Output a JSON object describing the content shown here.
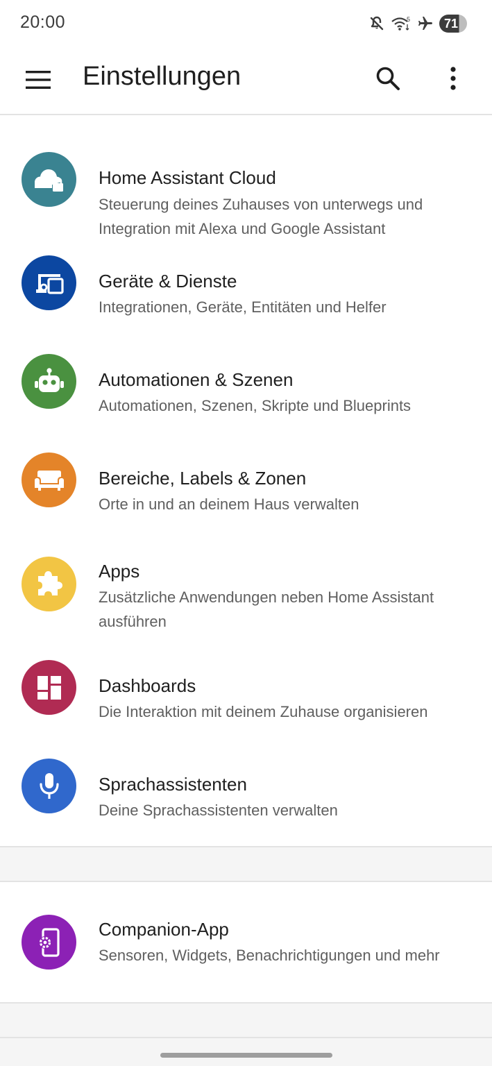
{
  "status_bar": {
    "time": "20:00",
    "battery": "71",
    "icons": [
      "mute-icon",
      "wifi-icon",
      "airplane-icon",
      "battery-icon"
    ]
  },
  "toolbar": {
    "title": "Einstellungen",
    "icons": [
      "menu-icon",
      "search-icon",
      "more-vert-icon"
    ]
  },
  "items": [
    {
      "title": "Home Assistant Cloud",
      "description": "Steuerung deines Zuhauses von unterwegs und Integration mit Alexa und Google Assistant",
      "icon": "cloud-lock-icon",
      "color": "#3a8391"
    },
    {
      "title": "Geräte & Dienste",
      "description": "Integrationen, Geräte, Entitäten und Helfer",
      "icon": "devices-icon",
      "color": "#0c47a1"
    },
    {
      "title": "Automationen & Szenen",
      "description": "Automationen, Szenen, Skripte und Blueprints",
      "icon": "robot-icon",
      "color": "#4a9140"
    },
    {
      "title": "Bereiche, Labels & Zonen",
      "description": "Orte in und an deinem Haus verwalten",
      "icon": "sofa-icon",
      "color": "#e48429"
    },
    {
      "title": "Apps",
      "description": "Zusätzliche Anwendungen neben Home Assistant ausführen",
      "icon": "puzzle-icon",
      "color": "#f2c544"
    },
    {
      "title": "Dashboards",
      "description": "Die Interaktion mit deinem Zuhause organisieren",
      "icon": "dashboard-icon",
      "color": "#b02b53"
    },
    {
      "title": "Sprachassistenten",
      "description": "Deine Sprachassistenten verwalten",
      "icon": "microphone-icon",
      "color": "#3068cc"
    },
    {
      "title": "Companion-App",
      "description": "Sensoren, Widgets, Benachrichtigungen und mehr",
      "icon": "cellphone-cog-icon",
      "color": "#8c21b5"
    }
  ]
}
